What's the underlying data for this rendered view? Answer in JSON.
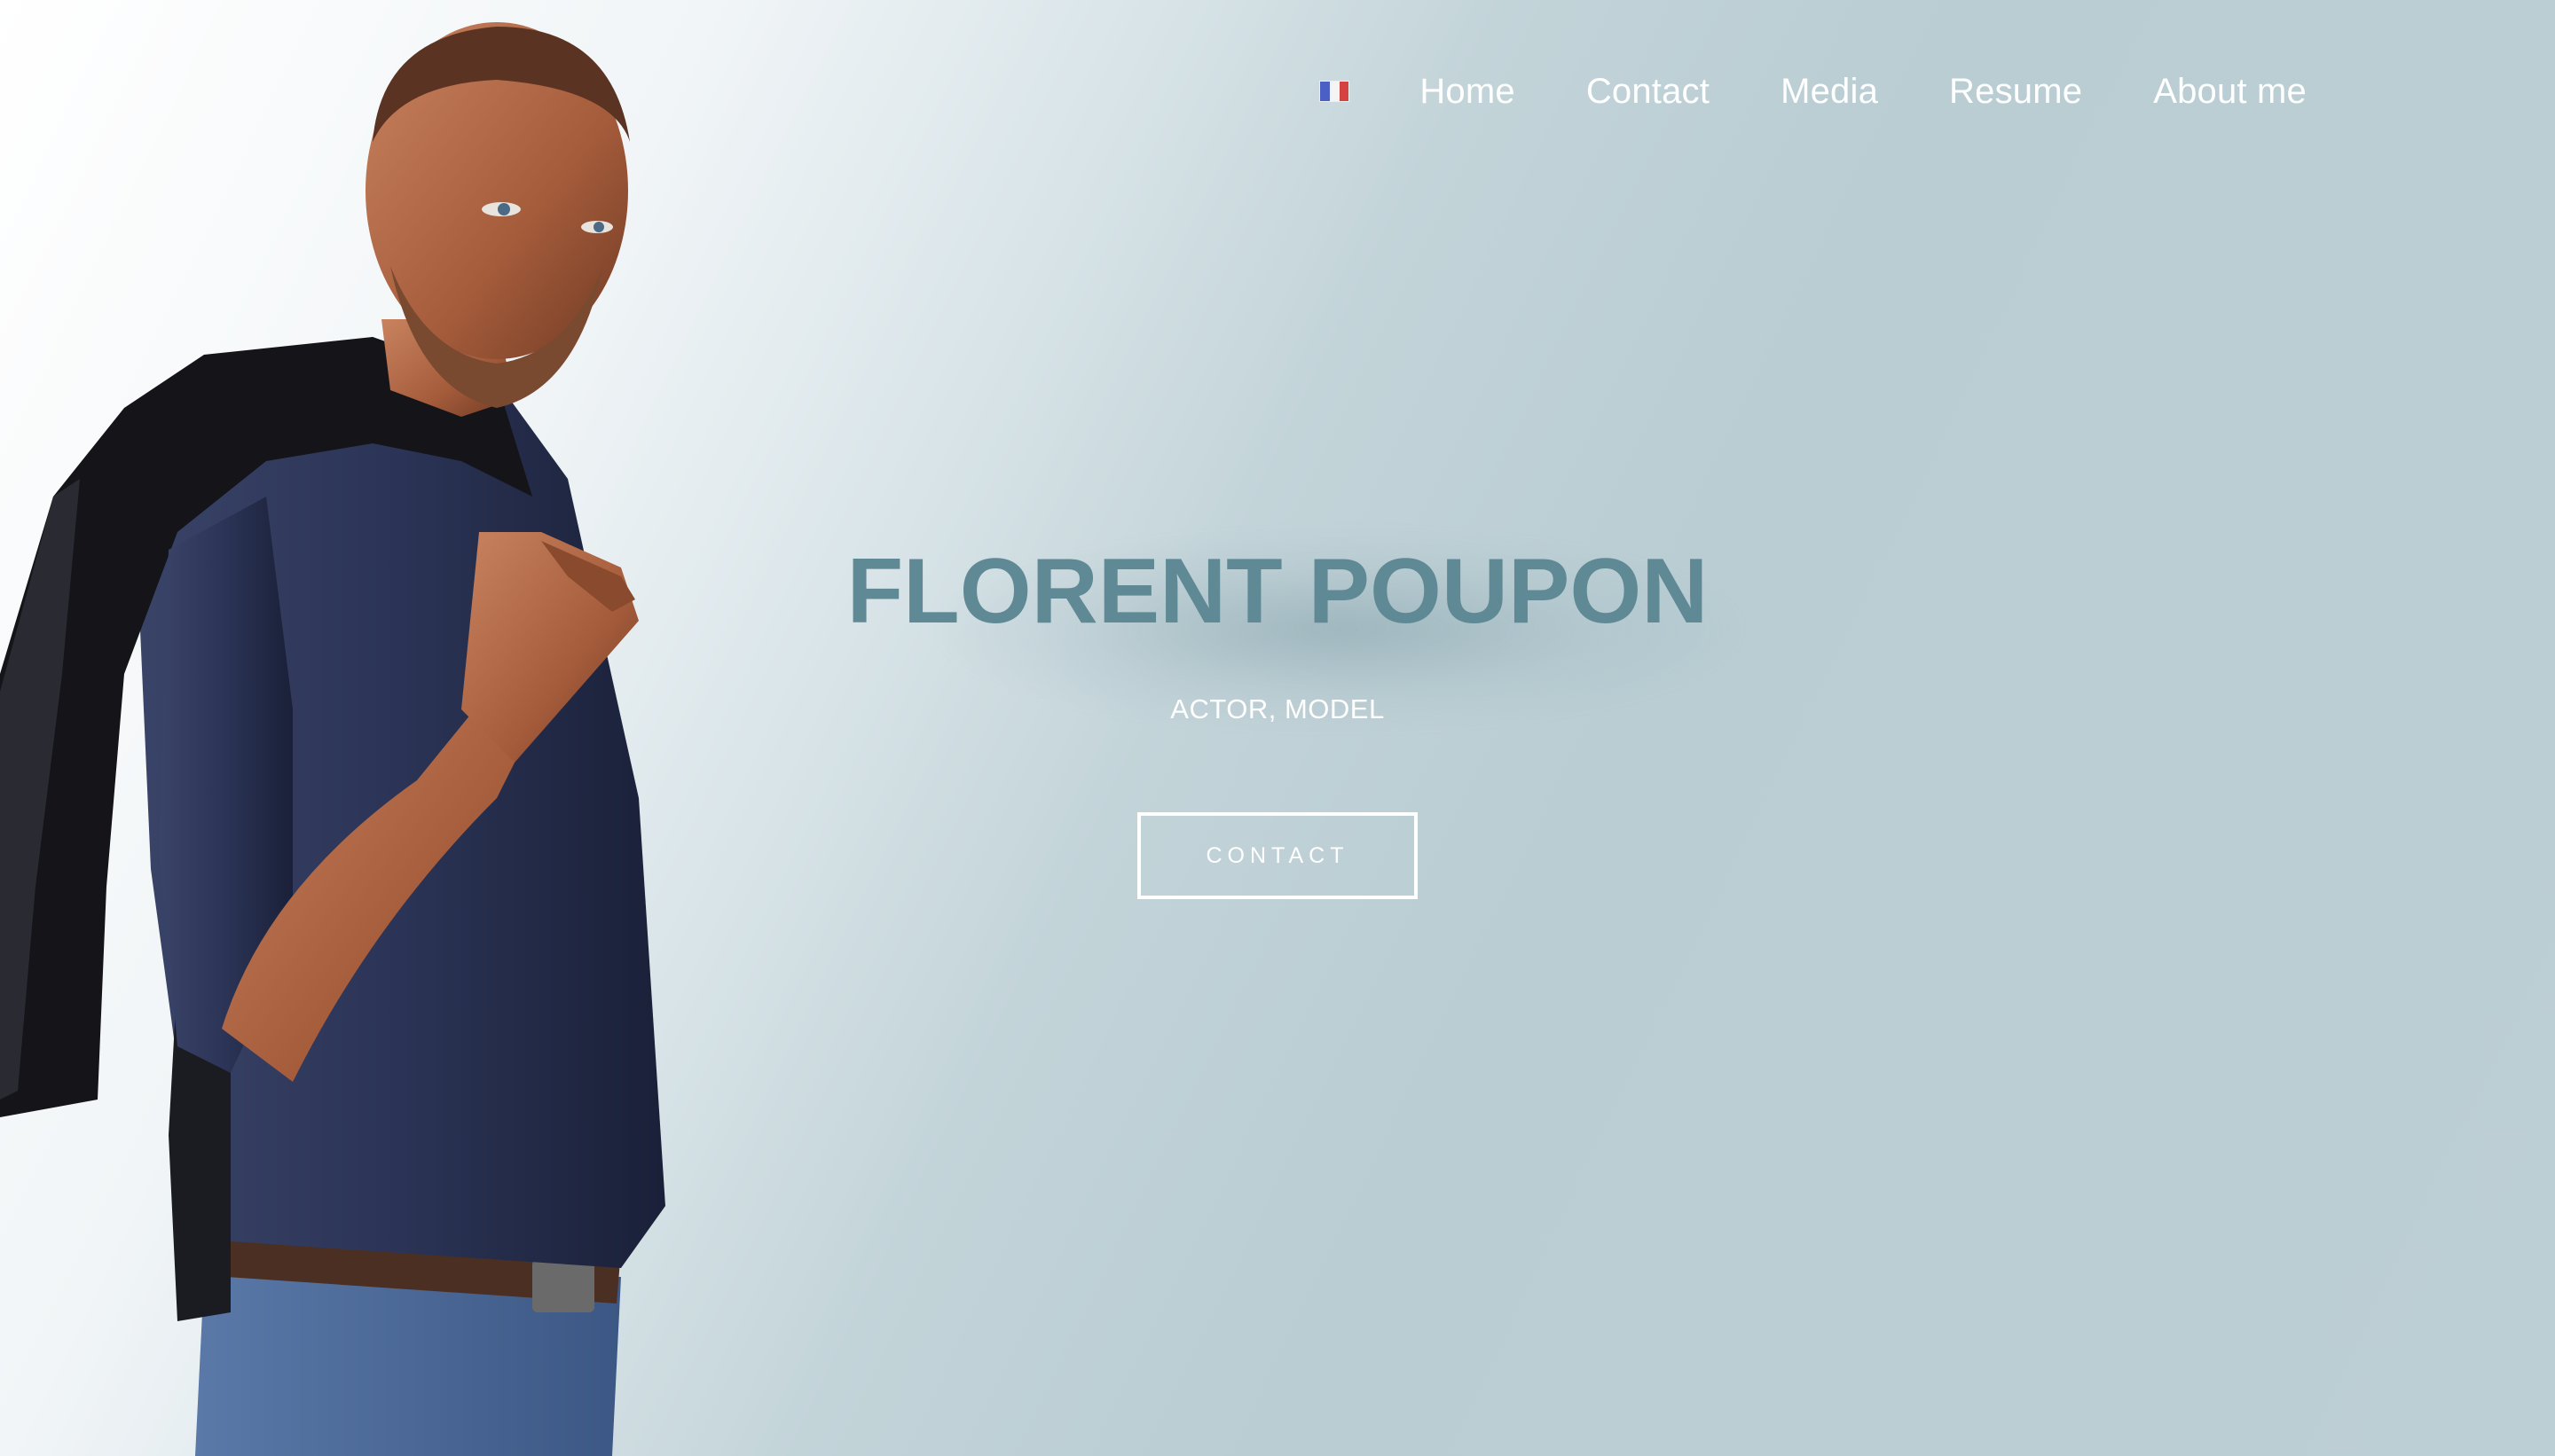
{
  "nav": {
    "flag_icon": "french-flag-icon",
    "items": [
      {
        "label": "Home"
      },
      {
        "label": "Contact"
      },
      {
        "label": "Media"
      },
      {
        "label": "Resume"
      },
      {
        "label": "About me"
      }
    ]
  },
  "hero": {
    "name": "FLORENT POUPON",
    "subtitle": "ACTOR, MODEL",
    "cta_label": "CONTACT"
  },
  "colors": {
    "name_color": "#5f8a95",
    "background": "#bccfd5",
    "flag_blue": "#4b5fc4",
    "flag_white": "#f4f4f4",
    "flag_red": "#d54341"
  }
}
